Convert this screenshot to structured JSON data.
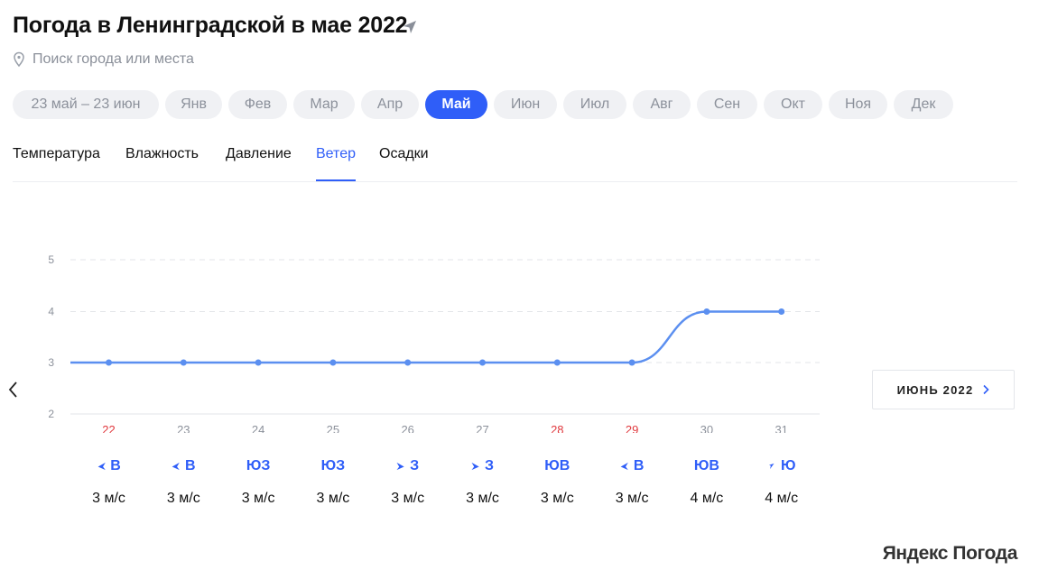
{
  "page": {
    "title": "Погода в Ленинградской в мае 2022",
    "search_placeholder": "Поиск города или места"
  },
  "months": [
    {
      "label": "23 май – 23 июн",
      "active": false
    },
    {
      "label": "Янв",
      "active": false
    },
    {
      "label": "Фев",
      "active": false
    },
    {
      "label": "Мар",
      "active": false
    },
    {
      "label": "Апр",
      "active": false
    },
    {
      "label": "Май",
      "active": true
    },
    {
      "label": "Июн",
      "active": false
    },
    {
      "label": "Июл",
      "active": false
    },
    {
      "label": "Авг",
      "active": false
    },
    {
      "label": "Сен",
      "active": false
    },
    {
      "label": "Окт",
      "active": false
    },
    {
      "label": "Ноя",
      "active": false
    },
    {
      "label": "Дек",
      "active": false
    }
  ],
  "tabs": [
    {
      "label": "Температура",
      "active": false
    },
    {
      "label": "Влажность",
      "active": false
    },
    {
      "label": "Давление",
      "active": false
    },
    {
      "label": "Ветер",
      "active": true
    },
    {
      "label": "Осадки",
      "active": false
    }
  ],
  "next_month_label": "ИЮНЬ 2022",
  "brand": "Яндекс Погода",
  "colors": {
    "accent": "#2f5ef8",
    "line": "#5b8ff0",
    "weekend": "#e0393e",
    "muted": "#8c919b"
  },
  "chart_data": {
    "type": "line",
    "y_ticks": [
      2,
      3,
      4,
      5
    ],
    "ylim": [
      2,
      5
    ],
    "grid": true,
    "x": [
      "22",
      "23",
      "24",
      "25",
      "26",
      "27",
      "28",
      "29",
      "30",
      "31"
    ],
    "values": [
      3,
      3,
      3,
      3,
      3,
      3,
      3,
      3,
      4,
      4
    ],
    "weekend": [
      true,
      false,
      false,
      false,
      false,
      false,
      true,
      true,
      false,
      false
    ],
    "directions": [
      "В",
      "В",
      "ЮЗ",
      "ЮЗ",
      "З",
      "З",
      "ЮВ",
      "В",
      "ЮВ",
      "Ю"
    ],
    "direction_icons": [
      "arrow-west-icon",
      "arrow-west-icon",
      "",
      "",
      "arrow-east-icon",
      "arrow-east-icon",
      "",
      "arrow-west-icon",
      "",
      "arrow-northeast-icon"
    ],
    "speeds": [
      "3 м/с",
      "3 м/с",
      "3 м/с",
      "3 м/с",
      "3 м/с",
      "3 м/с",
      "3 м/с",
      "3 м/с",
      "4 м/с",
      "4 м/с"
    ]
  }
}
